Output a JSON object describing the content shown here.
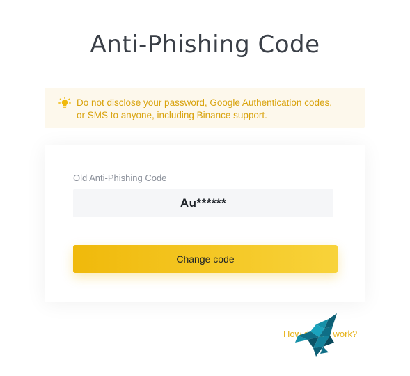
{
  "page": {
    "title": "Anti-Phishing Code"
  },
  "warning": {
    "icon": "lightbulb-icon",
    "line1": "Do not disclose your password, Google Authentication codes,",
    "line2": "or SMS to anyone, including Binance support.",
    "color": "#d9a30e",
    "background": "#fdf8ec"
  },
  "form": {
    "old_code_label": "Old Anti-Phishing Code",
    "old_code_value": "Au******",
    "change_button_label": "Change code",
    "accent": "#f0b90b"
  },
  "footer": {
    "help_link_label": "How does it work?"
  },
  "overlay": {
    "icon": "geometric-wolf-logo",
    "color": "#0f6e86"
  }
}
